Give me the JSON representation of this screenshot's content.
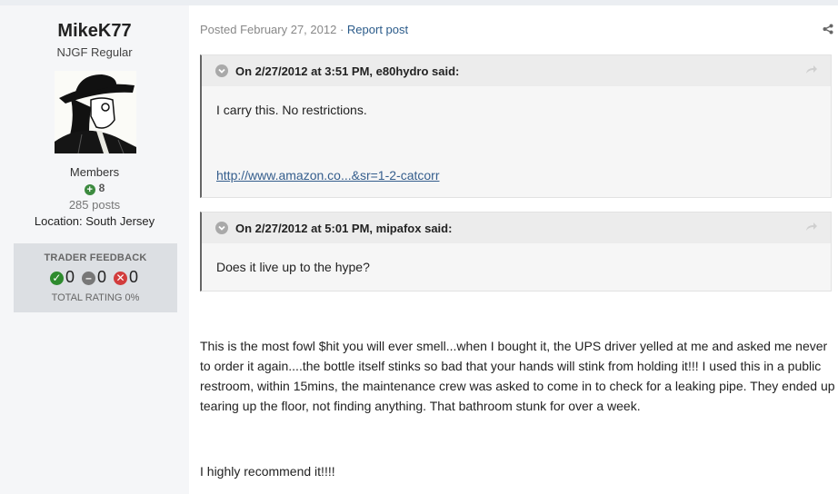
{
  "author": {
    "name": "MikeK77",
    "title": "NJGF Regular",
    "group": "Members",
    "reputation": "8",
    "posts": "285 posts",
    "location": "Location: South Jersey"
  },
  "feedback": {
    "title": "TRADER FEEDBACK",
    "positive": "0",
    "neutral": "0",
    "negative": "0",
    "total": "TOTAL RATING 0%",
    "colors": {
      "positive": "#2e8b2e",
      "neutral": "#777777",
      "negative": "#d23c3c"
    }
  },
  "post": {
    "posted": "Posted February 27, 2012",
    "separator": "·",
    "report_label": "Report post"
  },
  "quotes": [
    {
      "header": "On 2/27/2012 at 3:51 PM, e80hydro said:",
      "text": "I carry this. No restrictions.",
      "link": "http://www.amazon.co...&sr=1-2-catcorr"
    },
    {
      "header": "On 2/27/2012 at 5:01 PM, mipafox said:",
      "text": "Does it live up to the hype?"
    }
  ],
  "body": {
    "paragraph": "This is the most fowl $hit you will ever smell...when I bought it, the UPS driver yelled at me and asked me never to order it again....the bottle itself stinks so bad that your hands will stink from holding it!!! I used this in a public restroom, within 15mins, the maintenance crew was asked to come in to check for a leaking pipe. They ended up tearing up the floor, not finding anything. That bathroom stunk for over a week.",
    "closing": "I highly recommend it!!!!"
  },
  "icons": {
    "share": "share-icon",
    "quote_toggle": "chevron-down-icon",
    "quote_jump": "reply-arrow-icon",
    "reputation": "plus-circle-icon"
  }
}
